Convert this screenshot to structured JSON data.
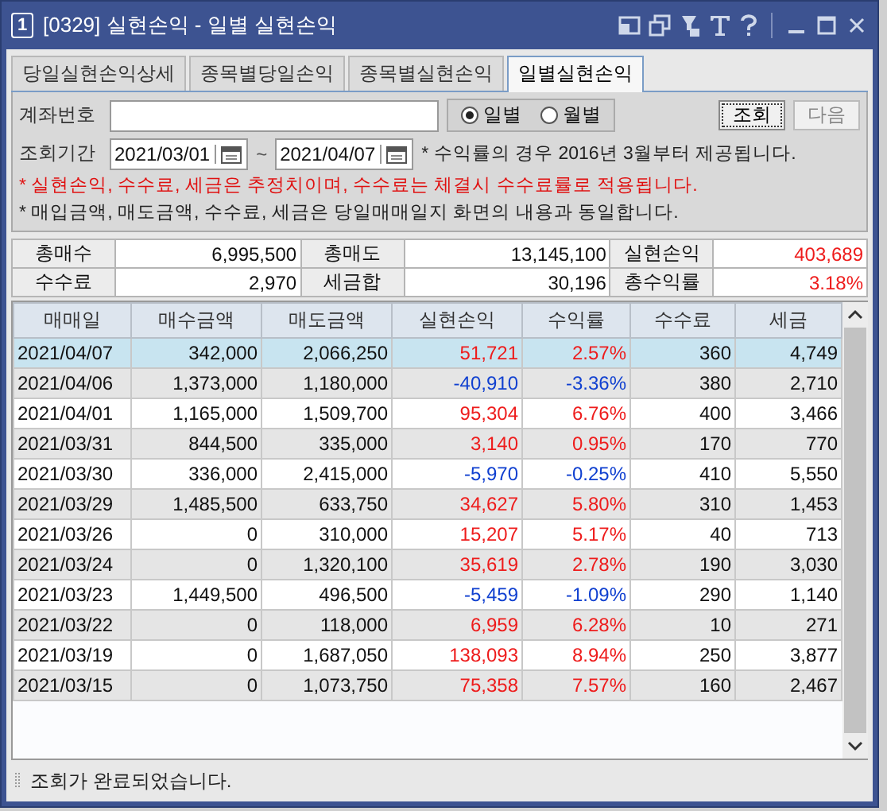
{
  "window": {
    "number": "1",
    "title": "[0329] 실현손익 - 일별 실현손익"
  },
  "tabs": [
    {
      "label": "당일실현손익상세",
      "selected": false
    },
    {
      "label": "종목별당일손익",
      "selected": false
    },
    {
      "label": "종목별실현손익",
      "selected": false
    },
    {
      "label": "일별실현손익",
      "selected": true
    }
  ],
  "form": {
    "account_label": "계좌번호",
    "period_options": [
      {
        "label": "일별",
        "selected": true
      },
      {
        "label": "월별",
        "selected": false
      }
    ],
    "buttons": [
      {
        "label": "조회",
        "disabled": false
      },
      {
        "label": "다음",
        "disabled": true
      }
    ],
    "period_label": "조회기간",
    "date_from": "2021/03/01",
    "tilde": "~",
    "date_to": "2021/04/07",
    "note": "* 수익률의 경우 2016년 3월부터 제공됩니다."
  },
  "notices": [
    {
      "text": "* 실현손익, 수수료, 세금은 추정치이며, 수수료는 체결시 수수료률로 적용됩니다.",
      "kind": "warning"
    },
    {
      "text": "* 매입금액, 매도금액, 수수료, 세금은 당일매매일지 화면의 내용과 동일합니다.",
      "kind": "info"
    }
  ],
  "summary": [
    [
      {
        "label": "총매수",
        "value": "6,995,500",
        "color": "#111111"
      },
      {
        "label": "총매도",
        "value": "13,145,100",
        "color": "#111111"
      },
      {
        "label": "실현손익",
        "value": "403,689",
        "color": "#ee1c1c"
      }
    ],
    [
      {
        "label": "수수료",
        "value": "2,970",
        "color": "#111111"
      },
      {
        "label": "세금합",
        "value": "30,196",
        "color": "#111111"
      },
      {
        "label": "총수익률",
        "value": "3.18%",
        "color": "#ee1c1c"
      }
    ]
  ],
  "table": {
    "columns": [
      "매매일",
      "매수금액",
      "매도금액",
      "실현손익",
      "수익률",
      "수수료",
      "세금"
    ],
    "rows": [
      {
        "cells": [
          "2021/04/07",
          "342,000",
          "2,066,250",
          "51,721",
          "2.57%",
          "360",
          "4,749"
        ],
        "color": "#ee1c1c",
        "selected": true
      },
      {
        "cells": [
          "2021/04/06",
          "1,373,000",
          "1,180,000",
          "-40,910",
          "-3.36%",
          "380",
          "2,710"
        ],
        "color": "#1040d0",
        "selected": false
      },
      {
        "cells": [
          "2021/04/01",
          "1,165,000",
          "1,509,700",
          "95,304",
          "6.76%",
          "400",
          "3,466"
        ],
        "color": "#ee1c1c",
        "selected": false
      },
      {
        "cells": [
          "2021/03/31",
          "844,500",
          "335,000",
          "3,140",
          "0.95%",
          "170",
          "770"
        ],
        "color": "#ee1c1c",
        "selected": false
      },
      {
        "cells": [
          "2021/03/30",
          "336,000",
          "2,415,000",
          "-5,970",
          "-0.25%",
          "410",
          "5,550"
        ],
        "color": "#1040d0",
        "selected": false
      },
      {
        "cells": [
          "2021/03/29",
          "1,485,500",
          "633,750",
          "34,627",
          "5.80%",
          "310",
          "1,453"
        ],
        "color": "#ee1c1c",
        "selected": false
      },
      {
        "cells": [
          "2021/03/26",
          "0",
          "310,000",
          "15,207",
          "5.17%",
          "40",
          "713"
        ],
        "color": "#ee1c1c",
        "selected": false
      },
      {
        "cells": [
          "2021/03/24",
          "0",
          "1,320,100",
          "35,619",
          "2.78%",
          "190",
          "3,030"
        ],
        "color": "#ee1c1c",
        "selected": false
      },
      {
        "cells": [
          "2021/03/23",
          "1,449,500",
          "496,500",
          "-5,459",
          "-1.09%",
          "290",
          "1,140"
        ],
        "color": "#1040d0",
        "selected": false
      },
      {
        "cells": [
          "2021/03/22",
          "0",
          "118,000",
          "6,959",
          "6.28%",
          "10",
          "271"
        ],
        "color": "#ee1c1c",
        "selected": false
      },
      {
        "cells": [
          "2021/03/19",
          "0",
          "1,687,050",
          "138,093",
          "8.94%",
          "250",
          "3,877"
        ],
        "color": "#ee1c1c",
        "selected": false
      },
      {
        "cells": [
          "2021/03/15",
          "0",
          "1,073,750",
          "75,358",
          "7.57%",
          "160",
          "2,467"
        ],
        "color": "#ee1c1c",
        "selected": false
      }
    ]
  },
  "status_bar": "조회가 완료되었습니다."
}
